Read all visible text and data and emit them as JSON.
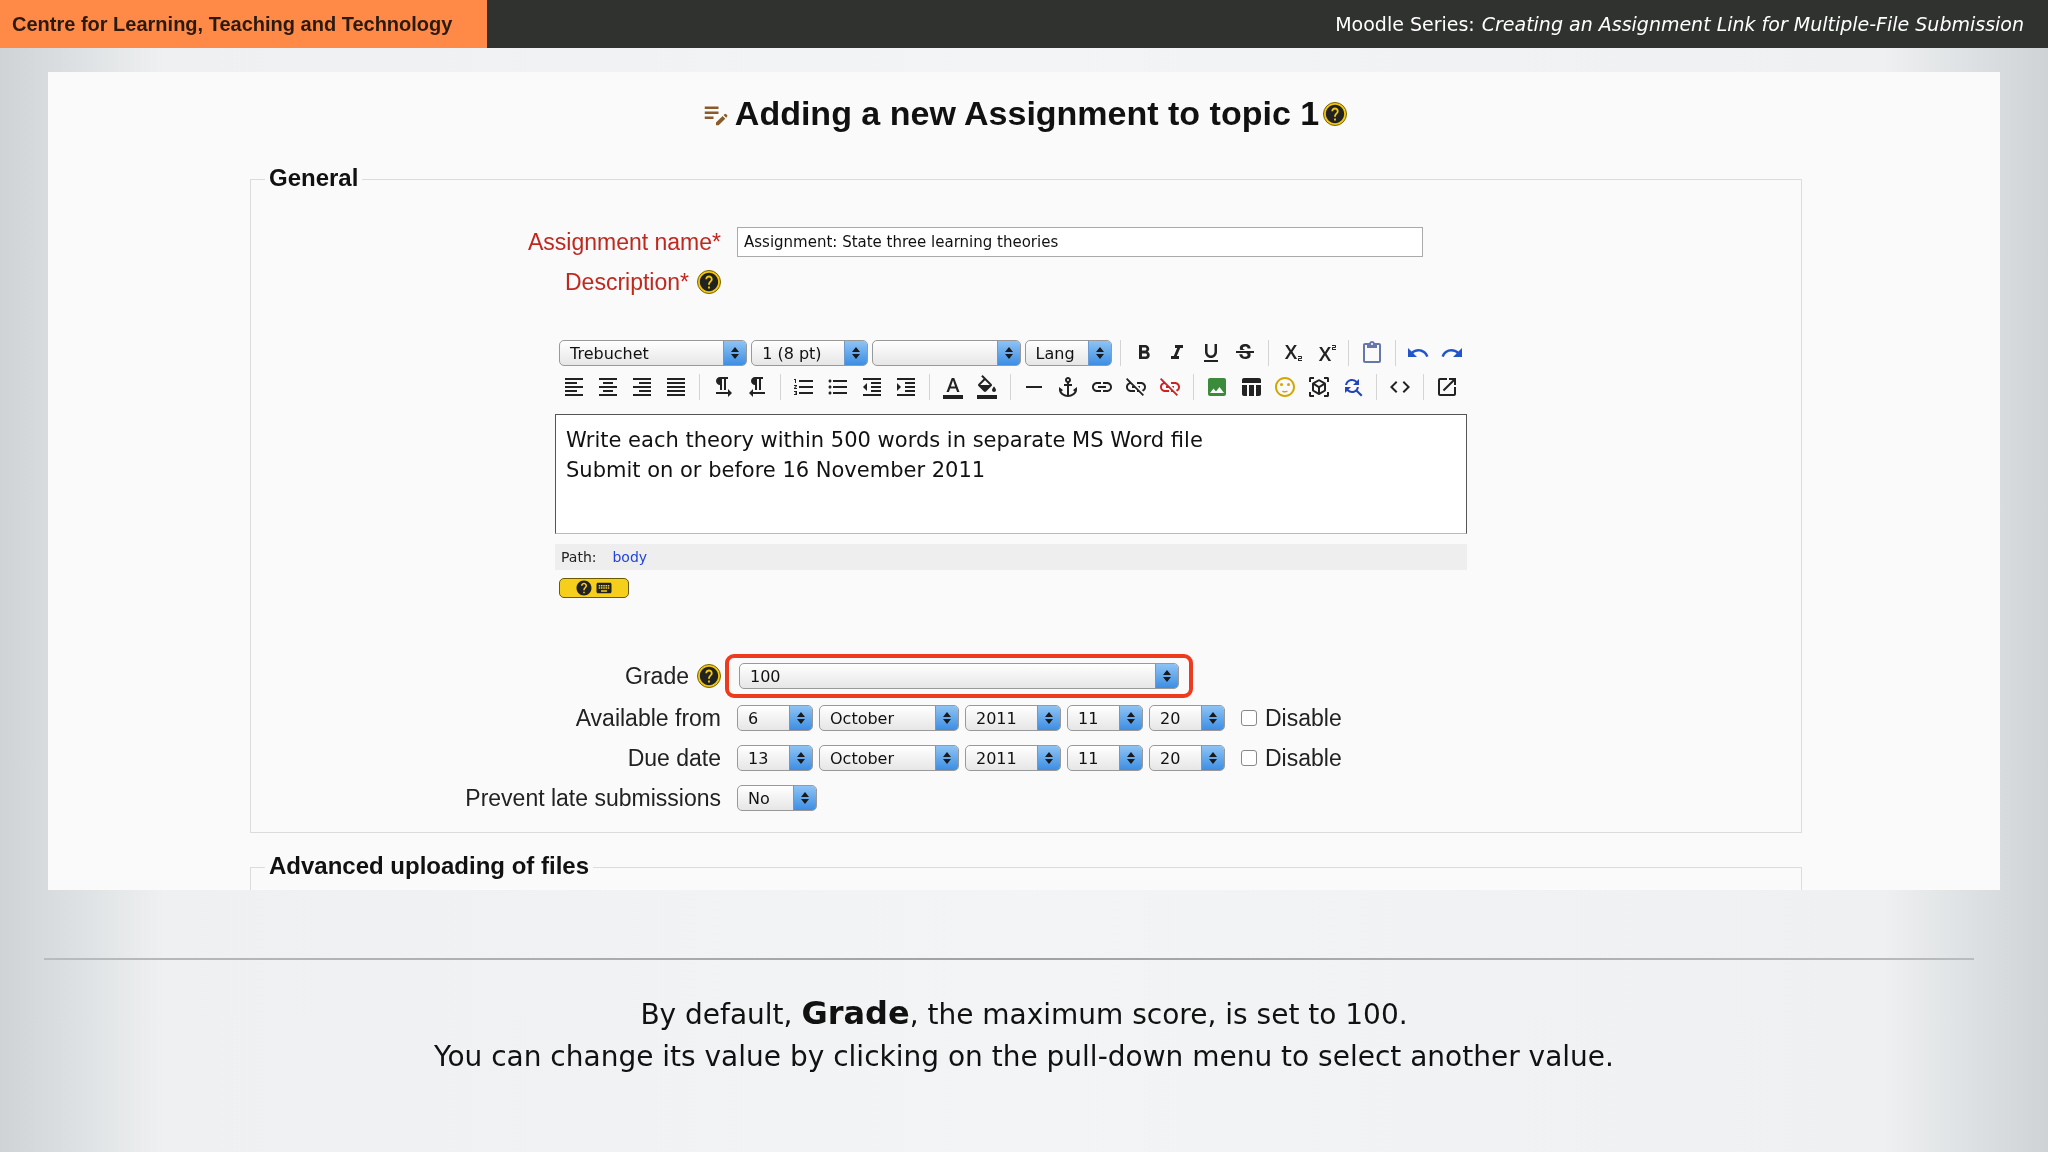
{
  "header": {
    "org": "Centre for Learning, Teaching and Technology",
    "series_label": "Moodle Series:",
    "series_title": "Creating an Assignment Link for Multiple-File Submission"
  },
  "page": {
    "title": "Adding a new Assignment to topic 1"
  },
  "general": {
    "legend": "General",
    "assignment_name": {
      "label": "Assignment name*",
      "value": "Assignment: State three learning theories"
    },
    "description": {
      "label": "Description*",
      "font": "Trebuchet",
      "size": "1 (8 pt)",
      "lang": "Lang",
      "lines": [
        "Write each theory within 500 words in separate MS Word file",
        "Submit on or before 16 November 2011"
      ],
      "path_label": "Path:",
      "path_link": "body"
    },
    "grade": {
      "label": "Grade",
      "value": "100",
      "highlighted": true
    },
    "dates": [
      {
        "label": "Available from",
        "day": "6",
        "month": "October",
        "year": "2011",
        "hour": "11",
        "minute": "20",
        "disable_label": "Disable",
        "checked": false
      },
      {
        "label": "Due date",
        "day": "13",
        "month": "October",
        "year": "2011",
        "hour": "11",
        "minute": "20",
        "disable_label": "Disable",
        "checked": false
      }
    ],
    "prevent_late": {
      "label": "Prevent late submissions",
      "value": "No"
    }
  },
  "advanced": {
    "legend": "Advanced uploading of files"
  },
  "caption": [
    "By default, **Grade**, the maximum score, is set to 100.",
    "You can change its value by clicking on the pull-down menu to select another value."
  ]
}
